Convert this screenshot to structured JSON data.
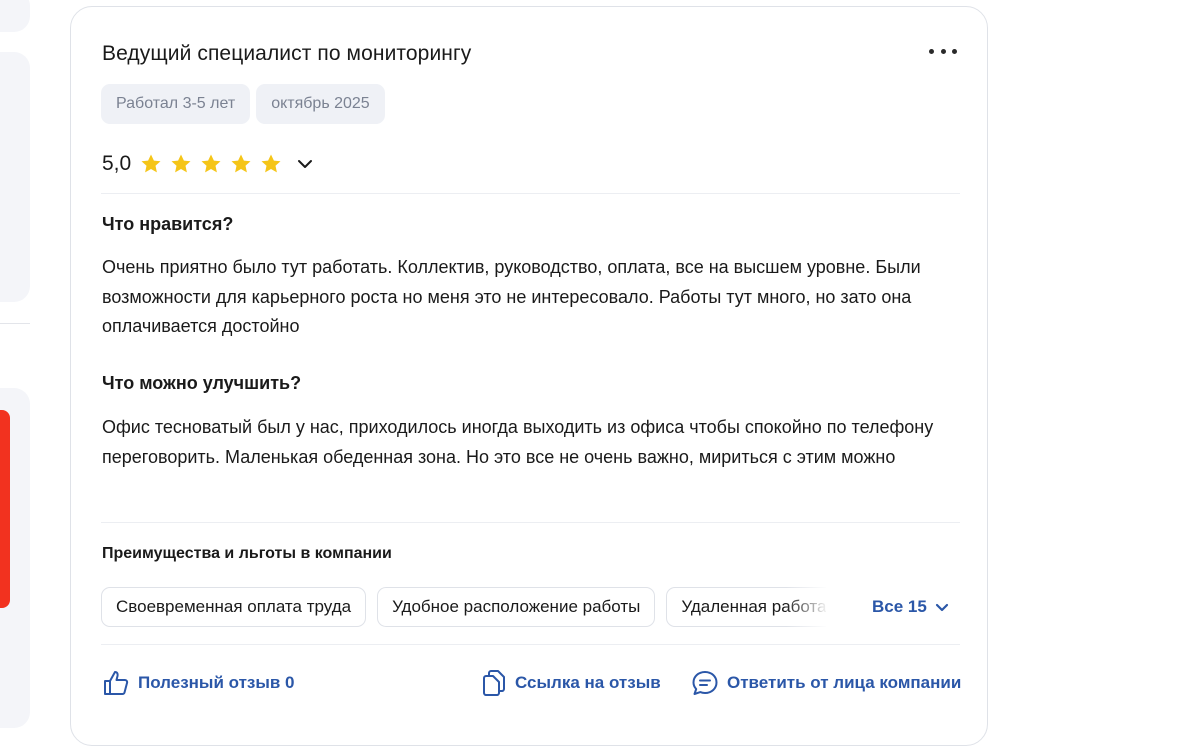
{
  "review": {
    "title": "Ведущий специалист по мониторингу",
    "tags": [
      "Работал 3-5 лет",
      "октябрь 2025"
    ],
    "rating": {
      "value": "5,0",
      "stars": 5,
      "max_stars": 5
    },
    "likes": {
      "heading": "Что нравится?",
      "text": "Очень приятно было тут работать. Коллектив, руководство, оплата, все на высшем уровне. Были возможности для карьерного роста но меня это не интересовало. Работы тут много, но зато она оплачивается достойно"
    },
    "improve": {
      "heading": "Что можно улучшить?",
      "text": "Офис тесноватый был у нас, приходилось иногда выходить из офиса чтобы спокойно по телефону переговорить. Маленькая обеденная зона. Но это все не очень важно, мириться с этим можно"
    },
    "benefits": {
      "title": "Преимущества и льготы в компании",
      "items": [
        "Своевременная оплата труда",
        "Удобное расположение работы",
        "Удаленная работа"
      ],
      "all_label": "Все 15"
    },
    "actions": {
      "helpful": "Полезный отзыв 0",
      "link": "Ссылка на отзыв",
      "reply": "Ответить от лица компании"
    }
  },
  "colors": {
    "accent_link": "#2b57a8",
    "star": "#f5c518",
    "tag_bg": "#eff1f6",
    "tag_text": "#7b8292",
    "brand_red": "#f2321f"
  },
  "icons": {
    "more": "three-dots-icon",
    "star": "star-icon",
    "toggle": "chevron-down-icon",
    "helpful": "thumbs-up-icon",
    "link": "copy-link-icon",
    "reply": "chat-bubble-icon"
  }
}
